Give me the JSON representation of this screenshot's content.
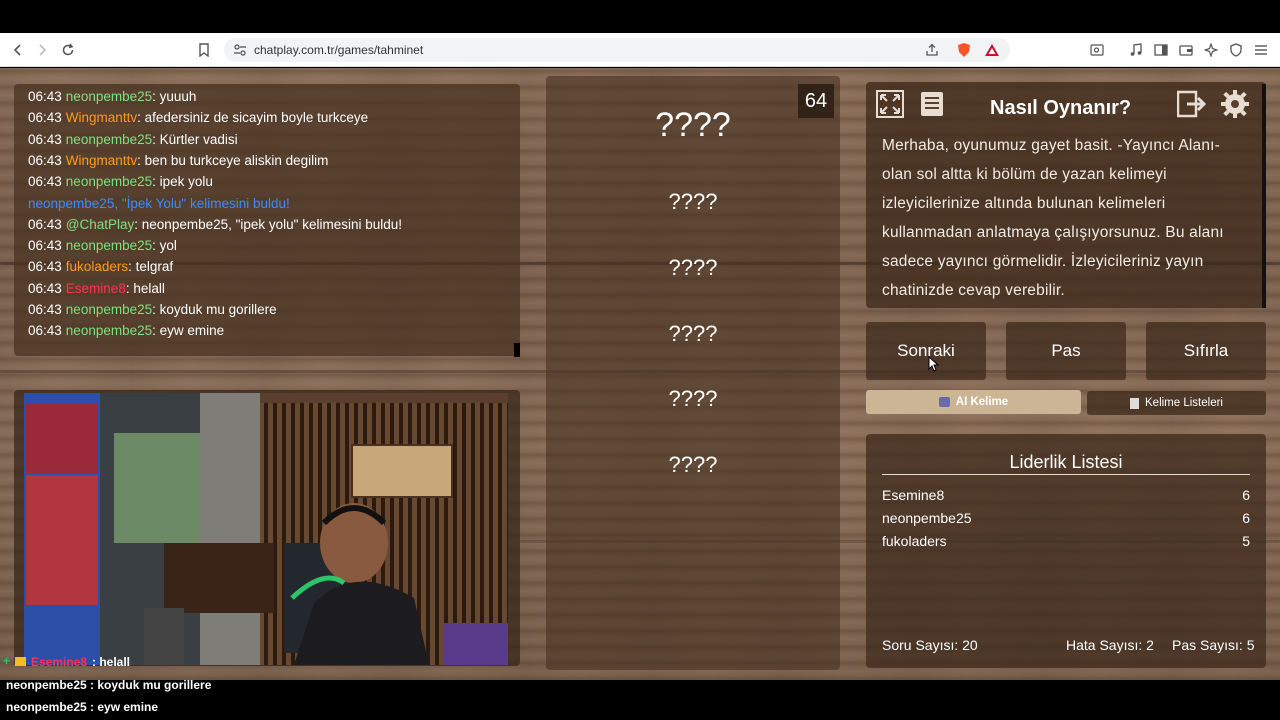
{
  "browser": {
    "url": "chatplay.com.tr/games/tahminet"
  },
  "chat": {
    "lines": [
      {
        "time": "06:43",
        "user": "neonpembe25",
        "user_color": "green",
        "text": ": yuuuh"
      },
      {
        "time": "06:43",
        "user": "Wingmanttv",
        "user_color": "orange",
        "text": ": afedersiniz de sicayim boyle turkceye"
      },
      {
        "time": "06:43",
        "user": "neonpembe25",
        "user_color": "green",
        "text": ": Kürtler vadisi"
      },
      {
        "time": "06:43",
        "user": "Wingmanttv",
        "user_color": "orange",
        "text": ": ben bu turkceye aliskin degilim"
      },
      {
        "time": "06:43",
        "user": "neonpembe25",
        "user_color": "green",
        "text": ": ipek yolu"
      },
      {
        "time": "",
        "user": "neonpembe25, \"İpek Yolu\" kelimesini buldu!",
        "user_color": "blue",
        "text": ""
      },
      {
        "time": "06:43",
        "user": "@ChatPlay",
        "user_color": "green",
        "text": ": neonpembe25, \"ipek yolu\" kelimesini buldu!"
      },
      {
        "time": "06:43",
        "user": "neonpembe25",
        "user_color": "green",
        "text": ": yol"
      },
      {
        "time": "06:43",
        "user": "fukoladers",
        "user_color": "orange",
        "text": ": telgraf"
      },
      {
        "time": "06:43",
        "user": "Esemine8",
        "user_color": "red",
        "text": ": helall"
      },
      {
        "time": "06:43",
        "user": "neonpembe25",
        "user_color": "green",
        "text": ": koyduk mu gorillere"
      },
      {
        "time": "06:43",
        "user": "neonpembe25",
        "user_color": "green",
        "text": ": eyw emine"
      }
    ]
  },
  "game": {
    "timer": "64",
    "main_word": "????",
    "hidden_words": [
      "????",
      "????",
      "????",
      "????",
      "????"
    ]
  },
  "howto": {
    "title": "Nasıl Oynanır?",
    "text": "Merhaba, oyunumuz gayet basit. -Yayıncı Alanı- olan sol altta ki bölüm de yazan kelimeyi izleyicilerinize altında bulunan kelimeleri kullanmadan anlatmaya çalışıyorsunuz. Bu alanı sadece yayıncı görmelidir. İzleyicileriniz yayın chatinizde cevap verebilir."
  },
  "controls": {
    "next": "Sonraki",
    "pass": "Pas",
    "reset": "Sıfırla",
    "ai_word": "AI Kelime",
    "word_lists": "Kelime Listeleri"
  },
  "leaderboard": {
    "title": "Liderlik Listesi",
    "rows": [
      {
        "name": "Esemine8",
        "score": "6"
      },
      {
        "name": "neonpembe25",
        "score": "6"
      },
      {
        "name": "fukoladers",
        "score": "5"
      }
    ],
    "question_count": "Soru Sayısı: 20",
    "error_count": "Hata Sayısı: 2",
    "pass_count": "Pas Sayısı: 5"
  },
  "overlay": {
    "line1_user": "Esemine8",
    "line1_text": " : helall",
    "line2": "neonpembe25 : koyduk mu gorillere",
    "line3": "neonpembe25 : eyw emine"
  },
  "colors": {
    "green": "#7ee07e",
    "orange": "#ff9a1f",
    "red": "#ff3050",
    "blue": "#3a8cff"
  }
}
